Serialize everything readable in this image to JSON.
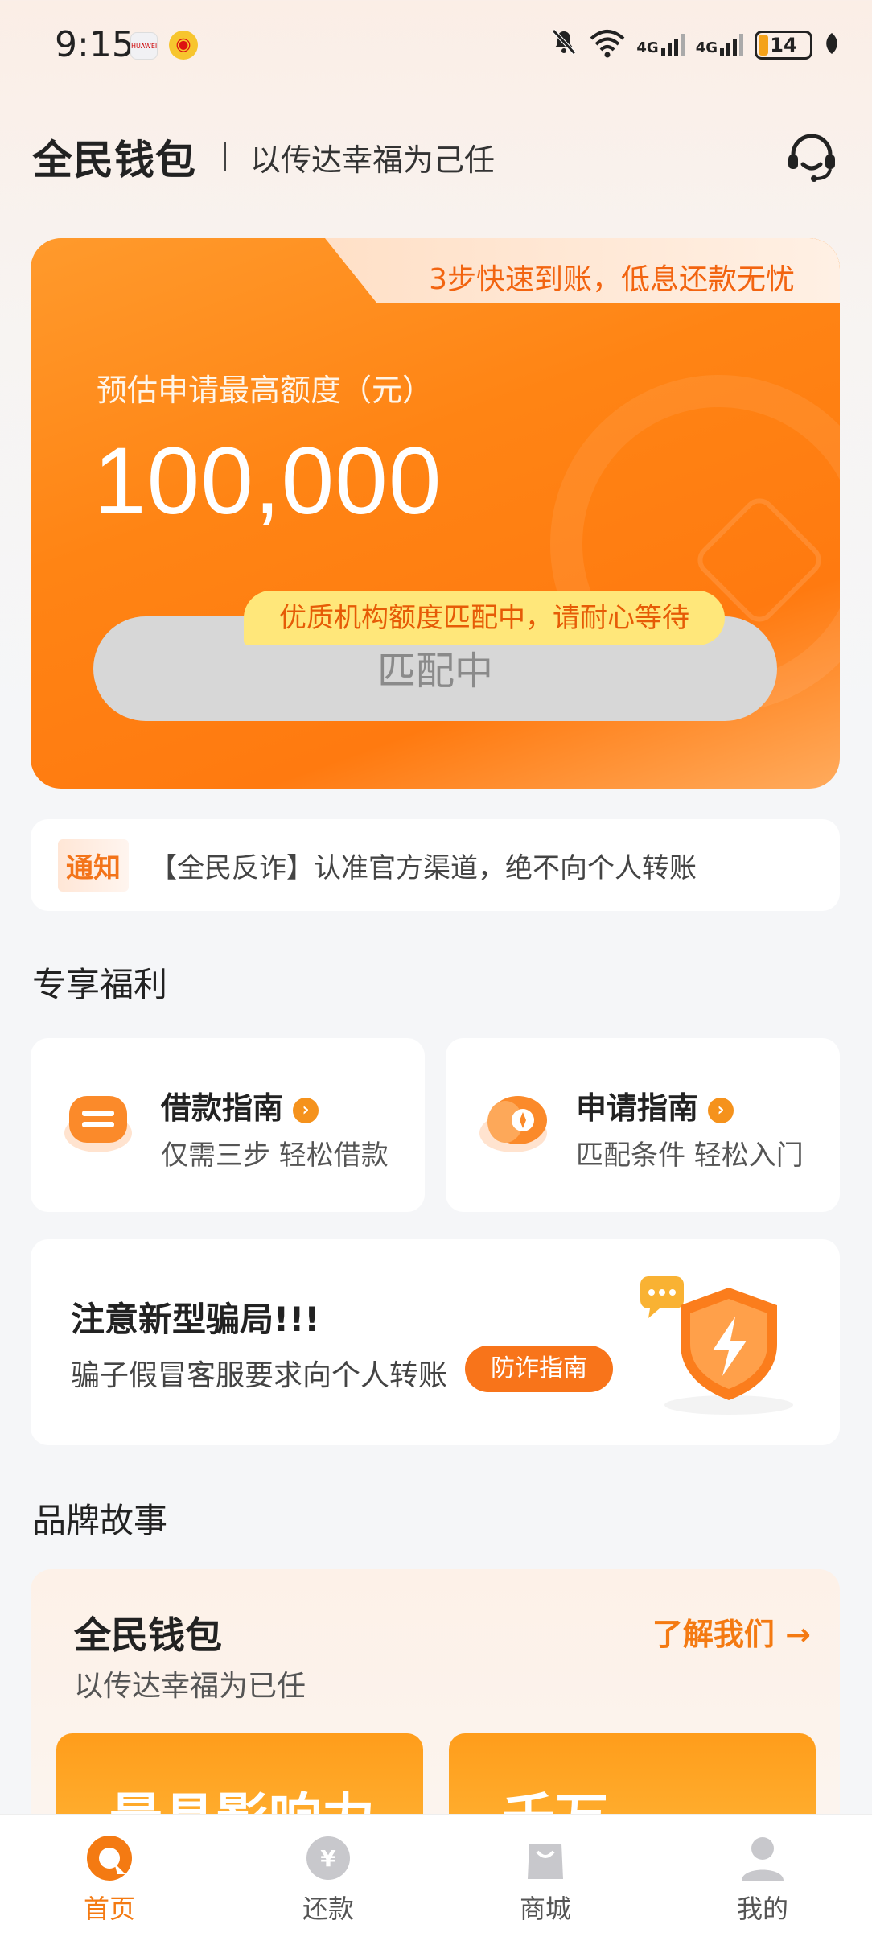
{
  "status_bar": {
    "time": "9:15",
    "app_icons": [
      "huawei-app-icon",
      "weibo-icon"
    ],
    "network": [
      "4G",
      "4G"
    ],
    "battery": "14",
    "icons": [
      "mute-bell-icon",
      "wifi-icon",
      "signal-icon",
      "signal-icon",
      "battery-icon",
      "leaf-icon"
    ]
  },
  "header": {
    "brand": "全民钱包",
    "slogan": "以传达幸福为己任",
    "support_icon": "customer-service-icon"
  },
  "hero": {
    "tab_text": "3步快速到账，低息还款无忧",
    "label": "预估申请最高额度（元）",
    "amount": "100,000",
    "tip": "优质机构额度匹配中，请耐心等待",
    "button": "匹配中"
  },
  "notice": {
    "badge": "通知",
    "text": "【全民反诈】认准官方渠道，绝不向个人转账"
  },
  "benefits": {
    "title": "专享福利",
    "cards": [
      {
        "title": "借款指南",
        "subtitle": "仅需三步 轻松借款",
        "icon": "loan-guide-icon"
      },
      {
        "title": "申请指南",
        "subtitle": "匹配条件 轻松入门",
        "icon": "apply-guide-icon"
      }
    ]
  },
  "fraud": {
    "title": "注意新型骗局!!!",
    "subtitle": "骗子假冒客服要求向个人转账",
    "button": "防诈指南",
    "icon": "shield-lightning-icon"
  },
  "story": {
    "section_title": "品牌故事",
    "title": "全民钱包",
    "subtitle": "以传达幸福为已任",
    "link": "了解我们 →",
    "images": [
      "最具影响力",
      "千万"
    ]
  },
  "bottom_nav": [
    {
      "label": "首页",
      "icon": "home-icon",
      "active": true
    },
    {
      "label": "还款",
      "icon": "repay-icon",
      "active": false
    },
    {
      "label": "商城",
      "icon": "shop-bag-icon",
      "active": false
    },
    {
      "label": "我的",
      "icon": "profile-icon",
      "active": false
    }
  ],
  "colors": {
    "accent": "#F47A12",
    "hero_orange": "#FF8414",
    "tip_yellow": "#FFE77A",
    "button_gray": "#D7D7D7"
  }
}
